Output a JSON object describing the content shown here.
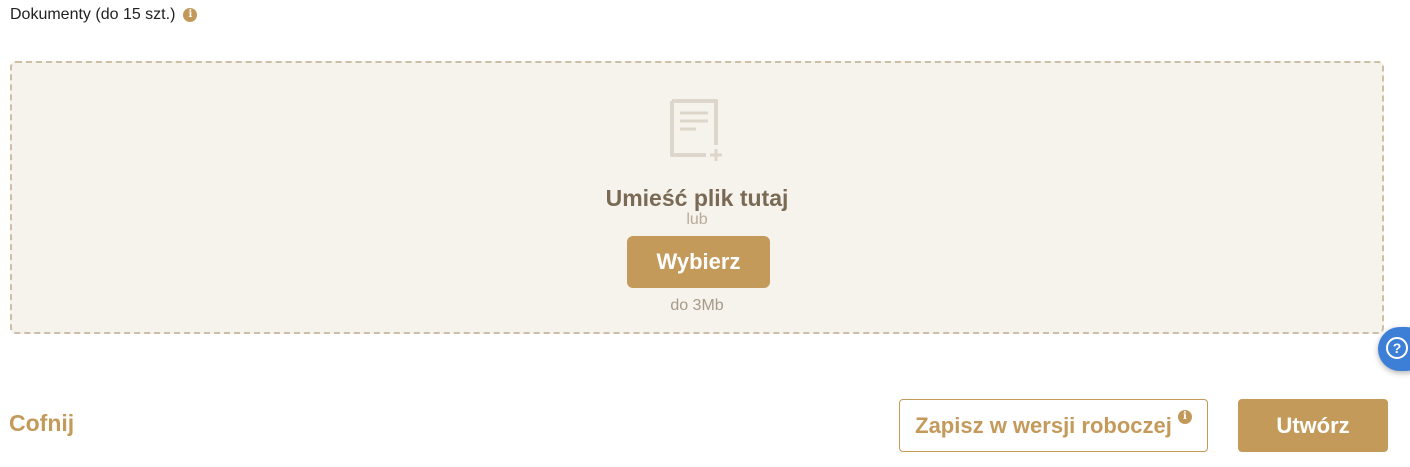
{
  "documents": {
    "label": "Dokumenty (do 15 szt.)",
    "info_icon": "info-icon"
  },
  "dropzone": {
    "icon": "add-document-icon",
    "title": "Umieść plik tutaj",
    "or_text": "lub",
    "choose_label": "Wybierz",
    "size_hint": "do 3Mb"
  },
  "help": {
    "icon": "help-icon",
    "glyph": "?"
  },
  "footer": {
    "back_label": "Cofnij",
    "draft_label": "Zapisz w wersji roboczej",
    "create_label": "Utwórz"
  },
  "colors": {
    "accent": "#c49a5b",
    "dropzone_bg": "#f6f3ec",
    "dropzone_border": "#cdbfa7",
    "help_bg": "#3d7fd6"
  }
}
